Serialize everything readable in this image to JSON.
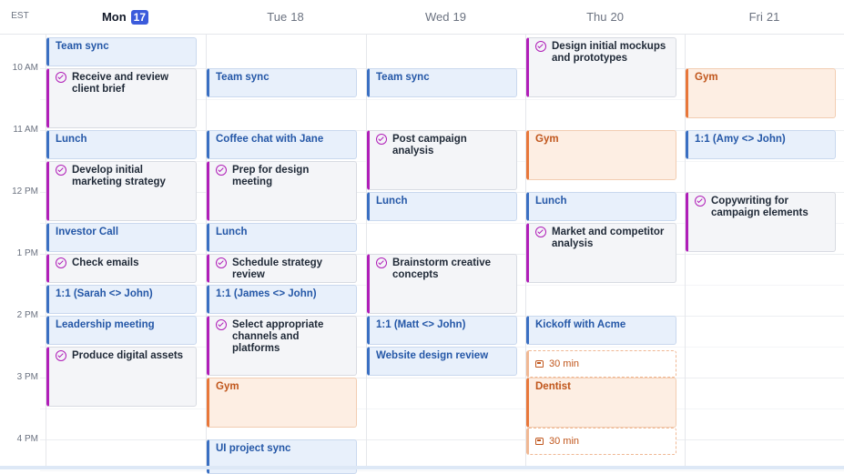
{
  "timezone": "EST",
  "days": [
    {
      "name": "Mon",
      "num": "17",
      "today": true
    },
    {
      "name": "Tue",
      "num": "18",
      "today": false
    },
    {
      "name": "Wed",
      "num": "19",
      "today": false
    },
    {
      "name": "Thu",
      "num": "20",
      "today": false
    },
    {
      "name": "Fri",
      "num": "21",
      "today": false
    }
  ],
  "time_labels": [
    "10 AM",
    "11 AM",
    "12 PM",
    "1 PM",
    "2 PM",
    "3 PM",
    "4 PM"
  ],
  "events": [
    {
      "day": 0,
      "start": 9.5,
      "end": 9.97,
      "kind": "blue",
      "title": "Team sync"
    },
    {
      "day": 0,
      "start": 10.0,
      "end": 10.97,
      "kind": "task",
      "title": "Receive and review client brief"
    },
    {
      "day": 0,
      "start": 11.0,
      "end": 11.47,
      "kind": "blue",
      "title": "Lunch"
    },
    {
      "day": 0,
      "start": 11.5,
      "end": 12.47,
      "kind": "task",
      "title": "Develop initial marketing strategy"
    },
    {
      "day": 0,
      "start": 12.5,
      "end": 12.97,
      "kind": "blue",
      "title": "Investor Call"
    },
    {
      "day": 0,
      "start": 13.0,
      "end": 13.47,
      "kind": "task",
      "title": "Check emails"
    },
    {
      "day": 0,
      "start": 13.5,
      "end": 13.97,
      "kind": "blue",
      "title": "1:1 (Sarah <> John)"
    },
    {
      "day": 0,
      "start": 14.0,
      "end": 14.47,
      "kind": "blue",
      "title": "Leadership meeting"
    },
    {
      "day": 0,
      "start": 14.5,
      "end": 15.47,
      "kind": "task",
      "title": "Produce digital assets"
    },
    {
      "day": 1,
      "start": 10.0,
      "end": 10.47,
      "kind": "blue",
      "title": "Team sync"
    },
    {
      "day": 1,
      "start": 11.0,
      "end": 11.47,
      "kind": "blue",
      "title": "Coffee chat with Jane"
    },
    {
      "day": 1,
      "start": 11.5,
      "end": 12.47,
      "kind": "task",
      "title": "Prep for design meeting"
    },
    {
      "day": 1,
      "start": 12.5,
      "end": 12.97,
      "kind": "blue",
      "title": "Lunch"
    },
    {
      "day": 1,
      "start": 13.0,
      "end": 13.47,
      "kind": "task",
      "title": "Schedule strategy review"
    },
    {
      "day": 1,
      "start": 13.5,
      "end": 13.97,
      "kind": "blue",
      "title": "1:1 (James <> John)"
    },
    {
      "day": 1,
      "start": 14.0,
      "end": 14.97,
      "kind": "task",
      "title": "Select appropriate channels and platforms"
    },
    {
      "day": 1,
      "start": 15.0,
      "end": 15.8,
      "kind": "orange",
      "title": "Gym"
    },
    {
      "day": 1,
      "start": 16.0,
      "end": 16.55,
      "kind": "blue",
      "title": "UI project sync"
    },
    {
      "day": 2,
      "start": 10.0,
      "end": 10.47,
      "kind": "blue",
      "title": "Team sync"
    },
    {
      "day": 2,
      "start": 11.0,
      "end": 11.97,
      "kind": "task",
      "title": "Post campaign analysis"
    },
    {
      "day": 2,
      "start": 12.0,
      "end": 12.47,
      "kind": "blue",
      "title": "Lunch"
    },
    {
      "day": 2,
      "start": 13.0,
      "end": 13.97,
      "kind": "task",
      "title": "Brainstorm creative concepts"
    },
    {
      "day": 2,
      "start": 14.0,
      "end": 14.47,
      "kind": "blue",
      "title": "1:1 (Matt <> John)"
    },
    {
      "day": 2,
      "start": 14.5,
      "end": 14.97,
      "kind": "blue",
      "title": "Website design review"
    },
    {
      "day": 3,
      "start": 9.5,
      "end": 10.47,
      "kind": "task",
      "title": "Design initial mockups and prototypes"
    },
    {
      "day": 3,
      "start": 11.0,
      "end": 11.8,
      "kind": "orange",
      "title": "Gym"
    },
    {
      "day": 3,
      "start": 12.0,
      "end": 12.47,
      "kind": "blue",
      "title": "Lunch"
    },
    {
      "day": 3,
      "start": 12.5,
      "end": 13.47,
      "kind": "task",
      "title": "Market and competitor analysis"
    },
    {
      "day": 3,
      "start": 14.0,
      "end": 14.47,
      "kind": "blue",
      "title": "Kickoff with Acme"
    },
    {
      "day": 3,
      "start": 14.55,
      "end": 15.0,
      "kind": "dashed",
      "title": "30 min"
    },
    {
      "day": 3,
      "start": 15.0,
      "end": 15.8,
      "kind": "orange",
      "title": "Dentist"
    },
    {
      "day": 3,
      "start": 15.8,
      "end": 16.25,
      "kind": "dashed",
      "title": "30 min"
    },
    {
      "day": 4,
      "start": 10.0,
      "end": 10.8,
      "kind": "orange",
      "title": "Gym"
    },
    {
      "day": 4,
      "start": 11.0,
      "end": 11.47,
      "kind": "blue",
      "title": "1:1 (Amy <> John)"
    },
    {
      "day": 4,
      "start": 12.0,
      "end": 12.97,
      "kind": "task",
      "title": "Copywriting for campaign elements"
    }
  ]
}
